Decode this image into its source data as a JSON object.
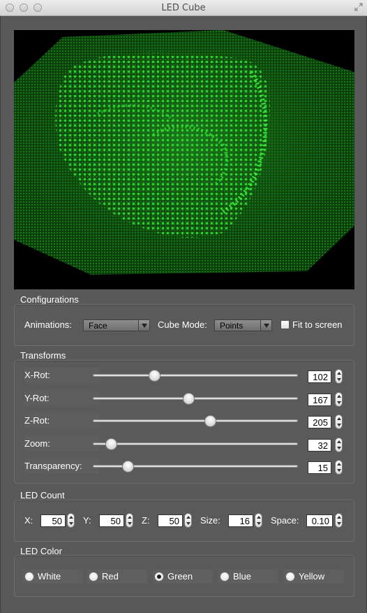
{
  "window": {
    "title": "LED Cube"
  },
  "configurations": {
    "title": "Configurations",
    "animations_label": "Animations:",
    "animations_value": "Face",
    "cube_mode_label": "Cube Mode:",
    "cube_mode_value": "Points",
    "fit_label": "Fit to screen",
    "fit_checked": false
  },
  "transforms": {
    "title": "Transforms",
    "rows": [
      {
        "label": "X-Rot:",
        "value": "102",
        "level": 0.3
      },
      {
        "label": "Y-Rot:",
        "value": "167",
        "level": 0.466
      },
      {
        "label": "Z-Rot:",
        "value": "205",
        "level": 0.57
      },
      {
        "label": "Zoom:",
        "value": "32",
        "level": 0.09
      },
      {
        "label": "Transparency:",
        "value": "15",
        "level": 0.17
      }
    ]
  },
  "led_count": {
    "title": "LED Count",
    "x_label": "X:",
    "x_value": "50",
    "y_label": "Y:",
    "y_value": "50",
    "z_label": "Z:",
    "z_value": "50",
    "size_label": "Size:",
    "size_value": "16",
    "space_label": "Space:",
    "space_value": "0.10"
  },
  "led_color": {
    "title": "LED Color",
    "options": [
      "White",
      "Red",
      "Green",
      "Blue",
      "Yellow"
    ],
    "selected": "Green"
  },
  "colors": {
    "led": "#22dd22",
    "background": "#595959"
  }
}
